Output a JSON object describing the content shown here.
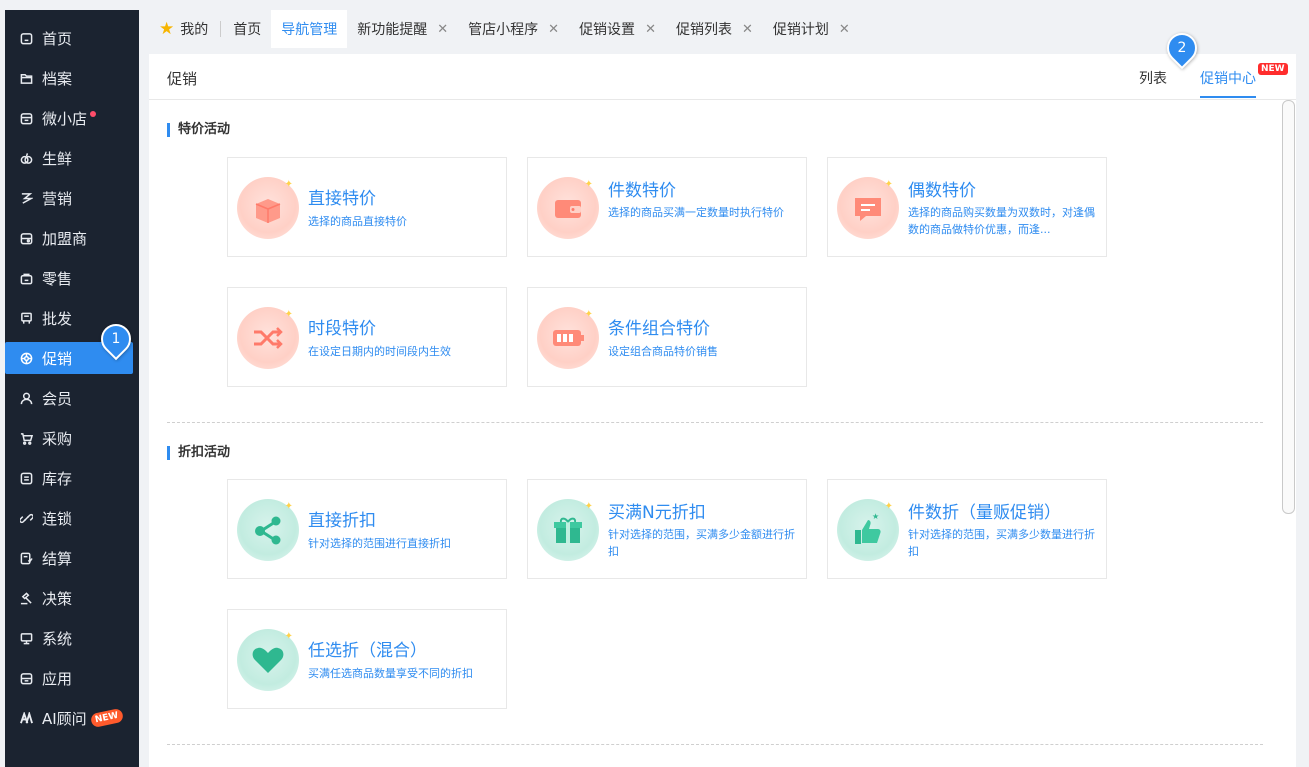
{
  "sidebar": {
    "items": [
      {
        "label": "首页",
        "icon": "home-icon"
      },
      {
        "label": "档案",
        "icon": "folder-icon"
      },
      {
        "label": "微小店",
        "icon": "shop-icon"
      },
      {
        "label": "生鲜",
        "icon": "fresh-icon"
      },
      {
        "label": "营销",
        "icon": "marketing-icon"
      },
      {
        "label": "加盟商",
        "icon": "franchise-icon"
      },
      {
        "label": "零售",
        "icon": "retail-icon"
      },
      {
        "label": "批发",
        "icon": "wholesale-icon"
      },
      {
        "label": "促销",
        "icon": "promotion-icon"
      },
      {
        "label": "会员",
        "icon": "member-icon"
      },
      {
        "label": "采购",
        "icon": "cart-icon"
      },
      {
        "label": "库存",
        "icon": "inventory-icon"
      },
      {
        "label": "连锁",
        "icon": "link-icon"
      },
      {
        "label": "结算",
        "icon": "settlement-icon"
      },
      {
        "label": "决策",
        "icon": "decision-icon"
      },
      {
        "label": "系统",
        "icon": "monitor-icon"
      },
      {
        "label": "应用",
        "icon": "app-icon"
      },
      {
        "label": "AI顾问",
        "icon": "ai-icon"
      }
    ],
    "active_index": 8,
    "ai_new_badge": "NEW"
  },
  "tabs": {
    "mine": "我的",
    "items": [
      "首页",
      "导航管理",
      "新功能提醒",
      "管店小程序",
      "促销设置",
      "促销列表",
      "促销计划"
    ],
    "close_glyph": "✕"
  },
  "header": {
    "title": "促销",
    "view_list": "列表",
    "view_center": "促销中心",
    "new_badge": "NEW"
  },
  "sections": [
    {
      "title": "特价活动",
      "cards": [
        {
          "title": "直接特价",
          "desc": "选择的商品直接特价",
          "icon": "gift-box-icon",
          "theme": "red"
        },
        {
          "title": "件数特价",
          "desc": "选择的商品买满一定数量时执行特价",
          "icon": "wallet-icon",
          "theme": "red"
        },
        {
          "title": "偶数特价",
          "desc": "选择的商品购买数量为双数时，对逢偶数的商品做特价优惠，而逢...",
          "icon": "message-icon",
          "theme": "red"
        },
        {
          "title": "时段特价",
          "desc": "在设定日期内的时间段内生效",
          "icon": "shuffle-icon",
          "theme": "red"
        },
        {
          "title": "条件组合特价",
          "desc": "设定组合商品特价销售",
          "icon": "combo-icon",
          "theme": "red"
        }
      ]
    },
    {
      "title": "折扣活动",
      "cards": [
        {
          "title": "直接折扣",
          "desc": "针对选择的范围进行直接折扣",
          "icon": "share-icon",
          "theme": "green"
        },
        {
          "title": "买满N元折扣",
          "desc": "针对选择的范围，买满多少金额进行折扣",
          "icon": "present-icon",
          "theme": "green"
        },
        {
          "title": "件数折（量贩促销）",
          "desc": "针对选择的范围，买满多少数量进行折扣",
          "icon": "thumbs-up-icon",
          "theme": "green"
        },
        {
          "title": "任选折（混合）",
          "desc": "买满任选商品数量享受不同的折扣",
          "icon": "heart-icon",
          "theme": "green"
        }
      ]
    }
  ],
  "markers": [
    "1",
    "2"
  ],
  "colors": {
    "accent": "#2f8cf0",
    "sidebar_bg": "#1b2330",
    "badge": "#ff2d2d"
  }
}
